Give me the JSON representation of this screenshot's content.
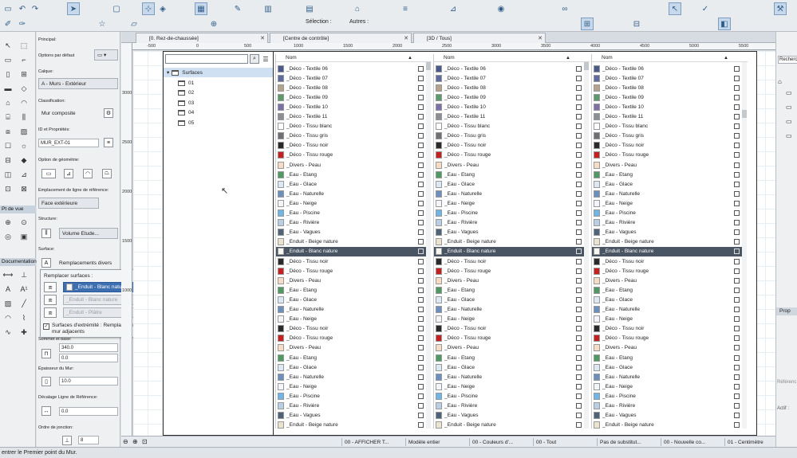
{
  "toolbar": {
    "selection_label": "Sélection :",
    "autres_label": "Autres :"
  },
  "toolbox": {
    "section_pt_de_vue": "Pt de vue",
    "section_documentation": "Documentation"
  },
  "infobox": {
    "principal_label": "Principal:",
    "options_label": "Options par défaut",
    "calque_label": "Calque:",
    "calque_value": "A - Murs - Extérieur",
    "classification_label": "Classification:",
    "classification_value": "Mur composite",
    "id_label": "ID et Propriétés:",
    "id_value": "MUR_EXT-01",
    "geometry_label": "Option de géométrie:",
    "ref_line_label": "Emplacement de ligne de référence:",
    "ref_line_value": "Face extérieure",
    "structure_label": "Structure:",
    "structure_value": "Volume Etude...",
    "surface_label": "Surface:",
    "surface_value": "Remplacements divers",
    "sommet_label": "Sommet et base:",
    "sommet_value": "340.0",
    "base_value": "0.0",
    "epaisseur_label": "Épaisseur du Mur:",
    "epaisseur_value": "10.0",
    "decalage_label": "Décalage Ligne de Référence:",
    "decalage_value": "0.0",
    "jonction_label": "Ordre de jonction:",
    "jonction_value": "8"
  },
  "popup": {
    "title": "Remplacer surfaces :",
    "rows": [
      {
        "label": "_Enduit - Blanc nature",
        "state": "selected"
      },
      {
        "label": "_Enduit - Blanc nature",
        "state": "disabled"
      },
      {
        "label": "_Enduit - Plâtre",
        "state": "disabled"
      }
    ],
    "checkbox_label": "Surfaces d'extrémité : Remplacer en utilisant mur adjacents"
  },
  "tabs": [
    {
      "label": "[0. Rez-de-chaussée]"
    },
    {
      "label": "[Centre de contrôle]"
    },
    {
      "label": "[3D / Tous]"
    }
  ],
  "rulers": {
    "h": [
      "-500",
      "0",
      "500",
      "1000",
      "1500",
      "2000",
      "2500",
      "3000",
      "3500",
      "4000",
      "4500",
      "5000",
      "5500"
    ],
    "v": [
      "3000",
      "2500",
      "2000",
      "1500",
      "1000"
    ]
  },
  "browser": {
    "tree_root": "Surfaces",
    "folders": [
      "01",
      "02",
      "03",
      "04",
      "05"
    ],
    "column_header": "Nom",
    "materials": [
      {
        "name": "_Déco - Textile 06",
        "color": "#4a5a8a"
      },
      {
        "name": "_Déco - Textile 07",
        "color": "#5e6aa0"
      },
      {
        "name": "_Déco - Textile 08",
        "color": "#b5a38d"
      },
      {
        "name": "_Déco - Textile 09",
        "color": "#5b9a6b"
      },
      {
        "name": "_Déco - Textile 10",
        "color": "#7e6fa8"
      },
      {
        "name": "_Déco - Textile 11",
        "color": "#8b8f93"
      },
      {
        "name": "_Déco - Tissu blanc",
        "color": "#ffffff"
      },
      {
        "name": "_Déco - Tissu gris",
        "color": "#6e7074"
      },
      {
        "name": "_Déco - Tissu noir",
        "color": "#2a2a2a"
      },
      {
        "name": "_Déco - Tissu rouge",
        "color": "#c81e1e"
      },
      {
        "name": "_Divers - Peau",
        "color": "#f6dcc4"
      },
      {
        "name": "_Eau - Etang",
        "color": "#4e9a62"
      },
      {
        "name": "_Eau - Glace",
        "color": "#dce9f5"
      },
      {
        "name": "_Eau - Naturelle",
        "color": "#6b8fbf"
      },
      {
        "name": "_Eau - Neige",
        "color": "#f2f6fb"
      },
      {
        "name": "_Eau - Piscine",
        "color": "#6fb6e8"
      },
      {
        "name": "_Eau - Rivière",
        "color": "#b8cfe6"
      },
      {
        "name": "_Eau - Vagues",
        "color": "#4e6378"
      },
      {
        "name": "_Enduit - Beige nature",
        "color": "#ece3cf"
      },
      {
        "name": "_Enduit - Blanc nature",
        "color": "#f7f7f2"
      },
      {
        "name": "_Déco - Tissu noir",
        "color": "#2a2a2a"
      },
      {
        "name": "_Déco - Tissu rouge",
        "color": "#c81e1e"
      },
      {
        "name": "_Divers - Peau",
        "color": "#f6dcc4"
      },
      {
        "name": "_Eau - Etang",
        "color": "#4e9a62"
      },
      {
        "name": "_Eau - Glace",
        "color": "#dce9f5"
      },
      {
        "name": "_Eau - Naturelle",
        "color": "#6b8fbf"
      },
      {
        "name": "_Eau - Neige",
        "color": "#f2f6fb"
      },
      {
        "name": "_Déco - Tissu noir",
        "color": "#2a2a2a"
      },
      {
        "name": "_Déco - Tissu rouge",
        "color": "#c81e1e"
      },
      {
        "name": "_Divers - Peau",
        "color": "#f6dcc4"
      },
      {
        "name": "_Eau - Etang",
        "color": "#4e9a62"
      },
      {
        "name": "_Eau - Glace",
        "color": "#dce9f5"
      },
      {
        "name": "_Eau - Naturelle",
        "color": "#6b8fbf"
      },
      {
        "name": "_Eau - Neige",
        "color": "#f2f6fb"
      },
      {
        "name": "_Eau - Piscine",
        "color": "#6fb6e8"
      },
      {
        "name": "_Eau - Rivière",
        "color": "#b8cfe6"
      },
      {
        "name": "_Eau - Vagues",
        "color": "#4e6378"
      },
      {
        "name": "_Enduit - Beige nature",
        "color": "#ece3cf"
      }
    ],
    "selected_index": 19,
    "selection_color": "#4a5563"
  },
  "viewbar": {
    "items": [
      "00 - AFFICHER T...",
      "Modèle entier",
      "00 - Couleurs d'...",
      "00 - Tout",
      "Pas de substitut...",
      "00 - Nouvelle co...",
      "01 - Centimètre"
    ]
  },
  "right_panel": {
    "search_label": "Recherch",
    "prop_label": "Prop",
    "ref_label": "Référenc",
    "actif_label": "Actif :"
  },
  "status": {
    "text": "entrer le Premier point du Mur."
  }
}
